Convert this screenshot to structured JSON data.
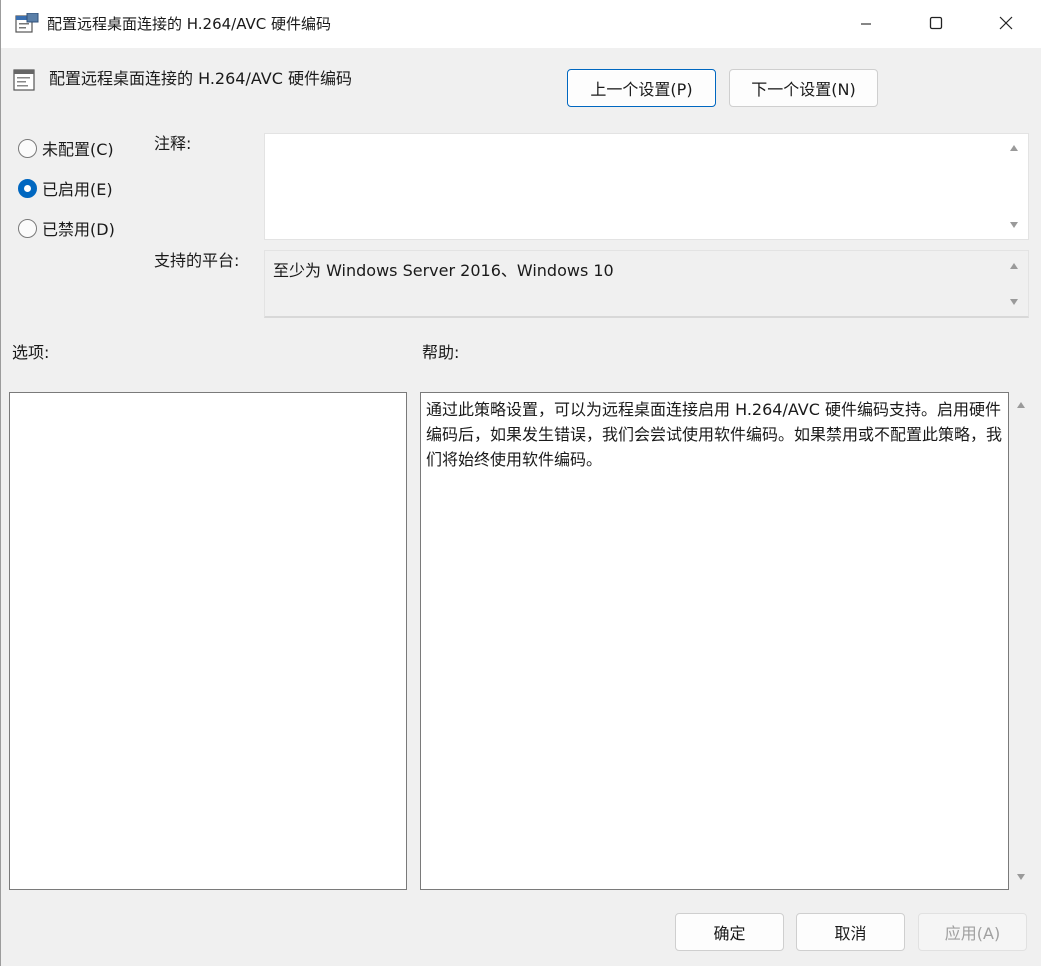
{
  "window": {
    "title": "配置远程桌面连接的 H.264/AVC 硬件编码"
  },
  "header": {
    "policy_title": "配置远程桌面连接的 H.264/AVC 硬件编码",
    "prev_button": "上一个设置(P)",
    "next_button": "下一个设置(N)"
  },
  "state": {
    "options": [
      {
        "label": "未配置(C)",
        "checked": false
      },
      {
        "label": "已启用(E)",
        "checked": true
      },
      {
        "label": "已禁用(D)",
        "checked": false
      }
    ]
  },
  "fields": {
    "comment_label": "注释:",
    "comment_value": "",
    "platform_label": "支持的平台:",
    "platform_value": "至少为 Windows Server 2016、Windows 10"
  },
  "panes": {
    "options_label": "选项:",
    "help_label": "帮助:",
    "help_text": "通过此策略设置，可以为远程桌面连接启用 H.264/AVC 硬件编码支持。启用硬件编码后，如果发生错误，我们会尝试使用软件编码。如果禁用或不配置此策略，我们将始终使用软件编码。"
  },
  "footer": {
    "ok_button": "确定",
    "cancel_button": "取消",
    "apply_button": "应用(A)"
  },
  "colors": {
    "accent": "#0067c0",
    "background": "#f0f0f0",
    "disabled_text": "#a0a0a0"
  }
}
